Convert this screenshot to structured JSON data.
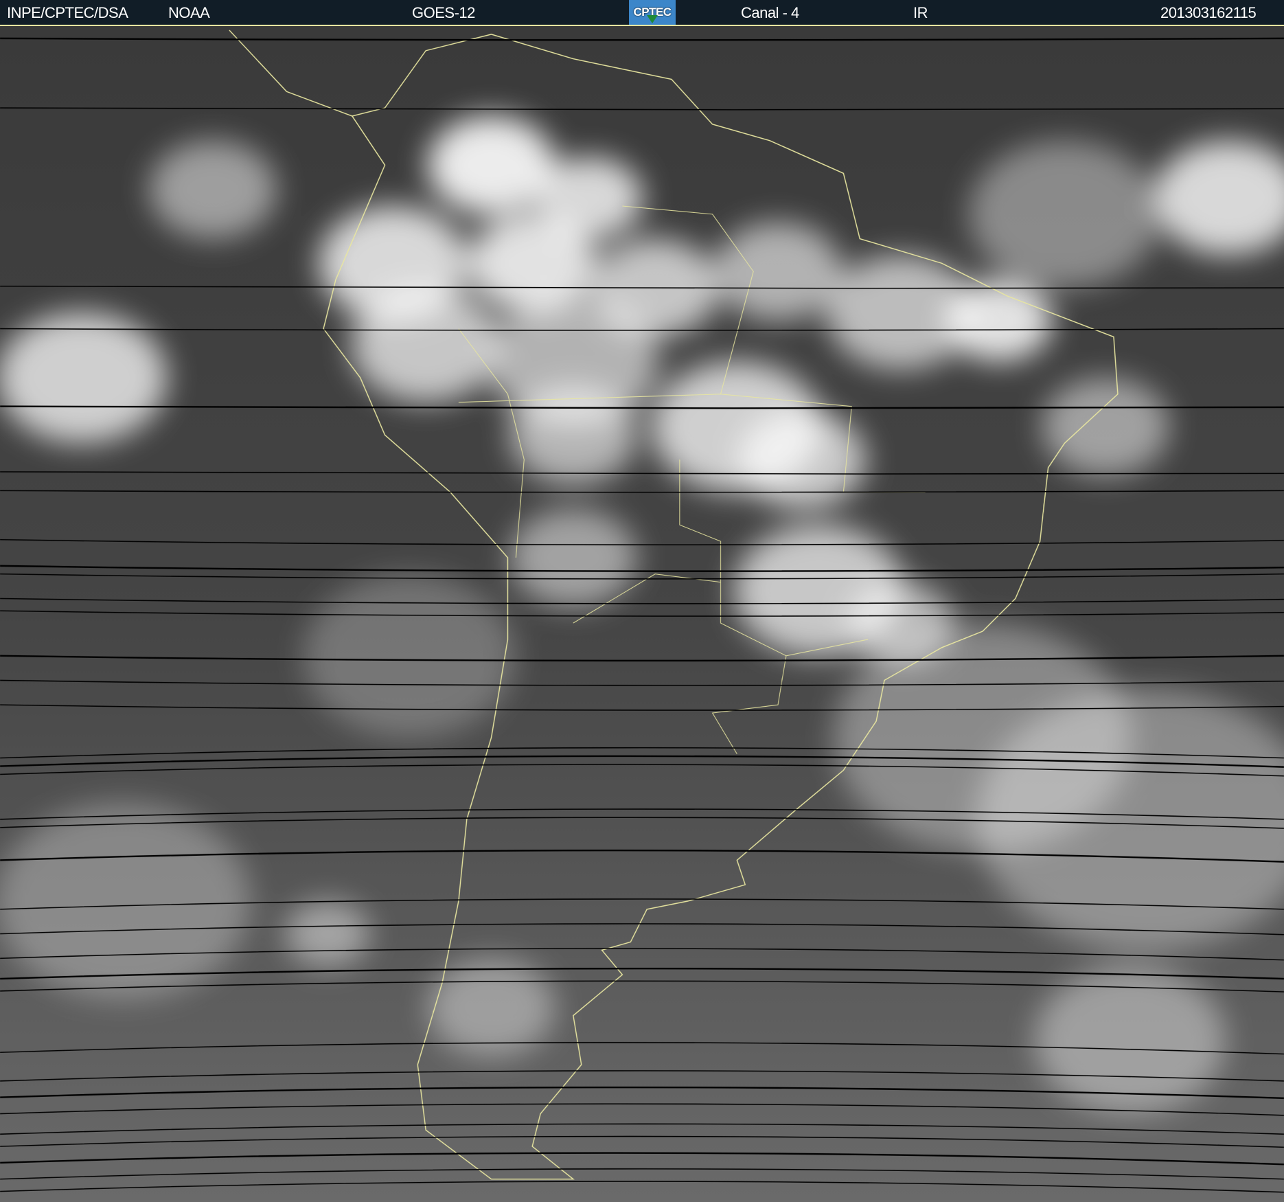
{
  "header": {
    "agency": "INPE/CPTEC/DSA",
    "source": "NOAA",
    "satellite": "GOES-12",
    "logo_text": "CPTEC",
    "channel": "Canal - 4",
    "band": "IR",
    "timestamp": "201303162115"
  },
  "colors": {
    "header_bg": "#111d27",
    "coastline": "#e8e6a0",
    "ocean_ir": "#4a4a4a",
    "cloud": "#ffffff"
  }
}
